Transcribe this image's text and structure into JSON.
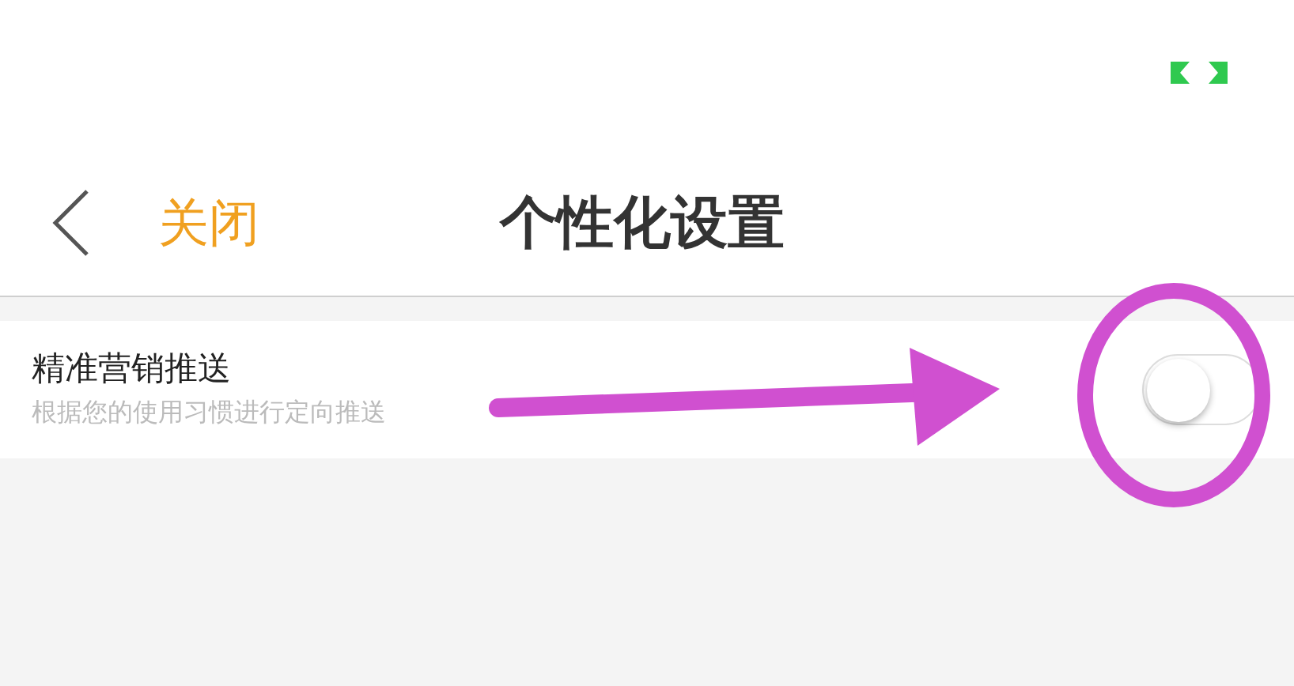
{
  "header": {
    "close_label": "关闭",
    "title": "个性化设置"
  },
  "settings": [
    {
      "title": "精准营销推送",
      "subtitle": "根据您的使用习惯进行定向推送",
      "on": false
    }
  ]
}
